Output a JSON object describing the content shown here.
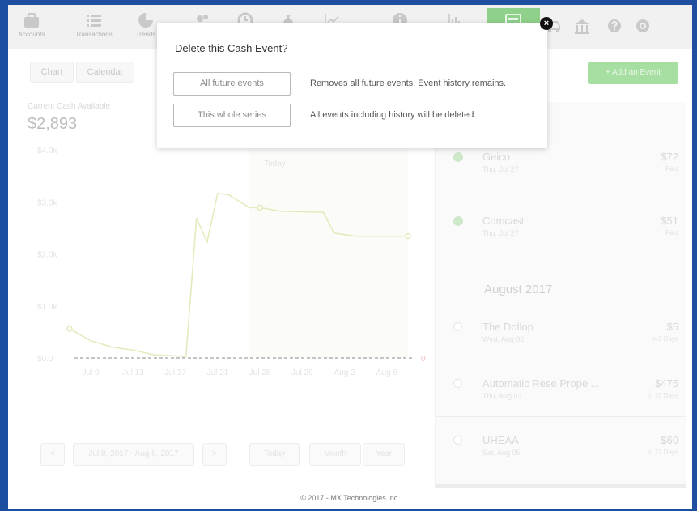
{
  "nav": {
    "items": [
      {
        "label": "Accounts",
        "icon": "briefcase-icon"
      },
      {
        "label": "Transactions",
        "icon": "list-icon"
      },
      {
        "label": "Trends",
        "icon": "pie-chart-icon"
      },
      {
        "label": "",
        "icon": "people-icon"
      },
      {
        "label": "",
        "icon": "clock-icon"
      },
      {
        "label": "",
        "icon": "money-bag-icon"
      },
      {
        "label": "",
        "icon": "line-chart-icon"
      },
      {
        "label": "",
        "icon": "info-icon"
      },
      {
        "label": "",
        "icon": "bar-chart-icon"
      },
      {
        "label": "",
        "icon": "cash-flow-icon",
        "active": true
      }
    ],
    "right_icons": [
      "car-icon",
      "bank-icon",
      "help-icon",
      "settings-icon"
    ],
    "active_color": "#8fd18b"
  },
  "toolbar": {
    "tab_chart": "Chart",
    "tab_calendar": "Calendar",
    "add_label": "+ Add an Event"
  },
  "summary": {
    "label": "Current Cash Available",
    "value": "$2,893"
  },
  "chart_data": {
    "type": "line",
    "x_tick_labels": [
      "Jul 9",
      "Jul 13",
      "Jul 17",
      "Jul 21",
      "Jul 25",
      "Jul 29",
      "Aug 2",
      "Aug 6"
    ],
    "y_tick_labels": [
      "$4.0k",
      "$3.0k",
      "$2.0k",
      "$1.0k",
      "$0.0"
    ],
    "ylim": [
      0,
      4000
    ],
    "today_label": "Today",
    "zero_marker": "0",
    "series": [
      {
        "x": [
          "Jul 7",
          "Jul 9",
          "Jul 11",
          "Jul 13",
          "Jul 15",
          "Jul 17",
          "Jul 18",
          "Jul 19",
          "Jul 20",
          "Jul 21",
          "Jul 22",
          "Jul 24",
          "Jul 25",
          "Jul 27",
          "Jul 31",
          "Aug 1",
          "Aug 3",
          "Aug 7",
          "Aug 8"
        ],
        "values": [
          560,
          330,
          210,
          150,
          60,
          40,
          20,
          2690,
          2230,
          3160,
          3140,
          2890,
          2890,
          2820,
          2800,
          2400,
          2340,
          2340,
          2340
        ]
      }
    ],
    "color": "#e3eabb"
  },
  "pager": {
    "prev": "<",
    "range": "Jul 8, 2017 - Aug 8, 2017",
    "next": ">",
    "today": "Today",
    "month": "Month",
    "year": "Year"
  },
  "events": {
    "month_header": "August 2017",
    "list": [
      {
        "name": "Geico",
        "date": "Thu, Jul 27",
        "amount": "$72",
        "sub": "Paid",
        "done": true
      },
      {
        "name": "Comcast",
        "date": "Thu, Jul 27",
        "amount": "$51",
        "sub": "Paid",
        "done": true
      },
      {
        "name": "The Dollop",
        "date": "Wed, Aug 02",
        "amount": "$5",
        "sub": "In 9 Days",
        "done": false
      },
      {
        "name": "Automatic Rese Prope ...",
        "date": "Thu, Aug 03",
        "amount": "$475",
        "sub": "In 10 Days",
        "done": false
      },
      {
        "name": "UHEAA",
        "date": "Sat, Aug 05",
        "amount": "$60",
        "sub": "In 12 Days",
        "done": false
      }
    ]
  },
  "modal": {
    "title": "Delete this Cash Event?",
    "option1_label": "All future events",
    "option1_desc": "Removes all future events. Event history remains.",
    "option2_label": "This whole series",
    "option2_desc": "All events including history will be deleted.",
    "close_icon": "close-icon"
  },
  "footer": {
    "text": "© 2017 - MX Technologies Inc."
  }
}
